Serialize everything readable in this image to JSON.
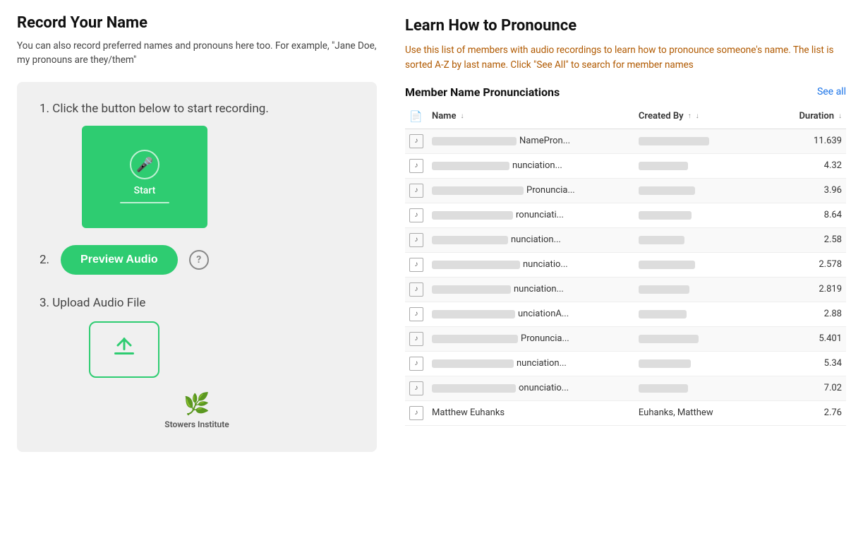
{
  "left": {
    "title": "Record Your Name",
    "subtitle": "You can also record preferred names and pronouns here too. For example, \"Jane Doe, my pronouns are they/them\"",
    "step1_label": "1. Click the button below to start recording.",
    "start_label": "Start",
    "step2_label": "2.",
    "preview_btn": "Preview Audio",
    "help_symbol": "?",
    "step3_label": "3.  Upload Audio File",
    "logo_label": "Stowers Institute"
  },
  "right": {
    "title": "Learn How to Pronounce",
    "description": "Use this list of members with audio recordings to learn how to pronounce someone's name. The list is sorted A-Z by last name. Click \"See All\" to search for member names",
    "table_title": "Member Name Pronunciations",
    "see_all": "See all",
    "columns": {
      "icon": "",
      "name": "Name",
      "created_by": "Created By",
      "duration": "Duration"
    },
    "rows": [
      {
        "name_blurred": 120,
        "name_text": "NamePron...",
        "created_blurred": 100,
        "duration": "11.639"
      },
      {
        "name_blurred": 110,
        "name_text": "nunciation...",
        "created_blurred": 70,
        "duration": "4.32"
      },
      {
        "name_blurred": 130,
        "name_text": "Pronuncia...",
        "created_blurred": 80,
        "duration": "3.96"
      },
      {
        "name_blurred": 115,
        "name_text": "ronunciati...",
        "created_blurred": 75,
        "duration": "8.64"
      },
      {
        "name_blurred": 108,
        "name_text": "nunciation...",
        "created_blurred": 65,
        "duration": "2.58"
      },
      {
        "name_blurred": 125,
        "name_text": "nunciatio...",
        "created_blurred": 80,
        "duration": "2.578"
      },
      {
        "name_blurred": 112,
        "name_text": "nunciation...",
        "created_blurred": 72,
        "duration": "2.819"
      },
      {
        "name_blurred": 118,
        "name_text": "unciationA...",
        "created_blurred": 68,
        "duration": "2.88"
      },
      {
        "name_blurred": 122,
        "name_text": "Pronuncia...",
        "created_blurred": 85,
        "duration": "5.401"
      },
      {
        "name_blurred": 116,
        "name_text": "nunciation...",
        "created_blurred": 74,
        "duration": "5.34"
      },
      {
        "name_blurred": 119,
        "name_text": "onunciatio...",
        "created_blurred": 70,
        "duration": "7.02"
      },
      {
        "name_blurred": 0,
        "name_text": "Matthew Euhanks",
        "created_blurred": 0,
        "created_text": "Euhanks, Matthew",
        "duration": "2.76",
        "name_full": true
      }
    ]
  }
}
